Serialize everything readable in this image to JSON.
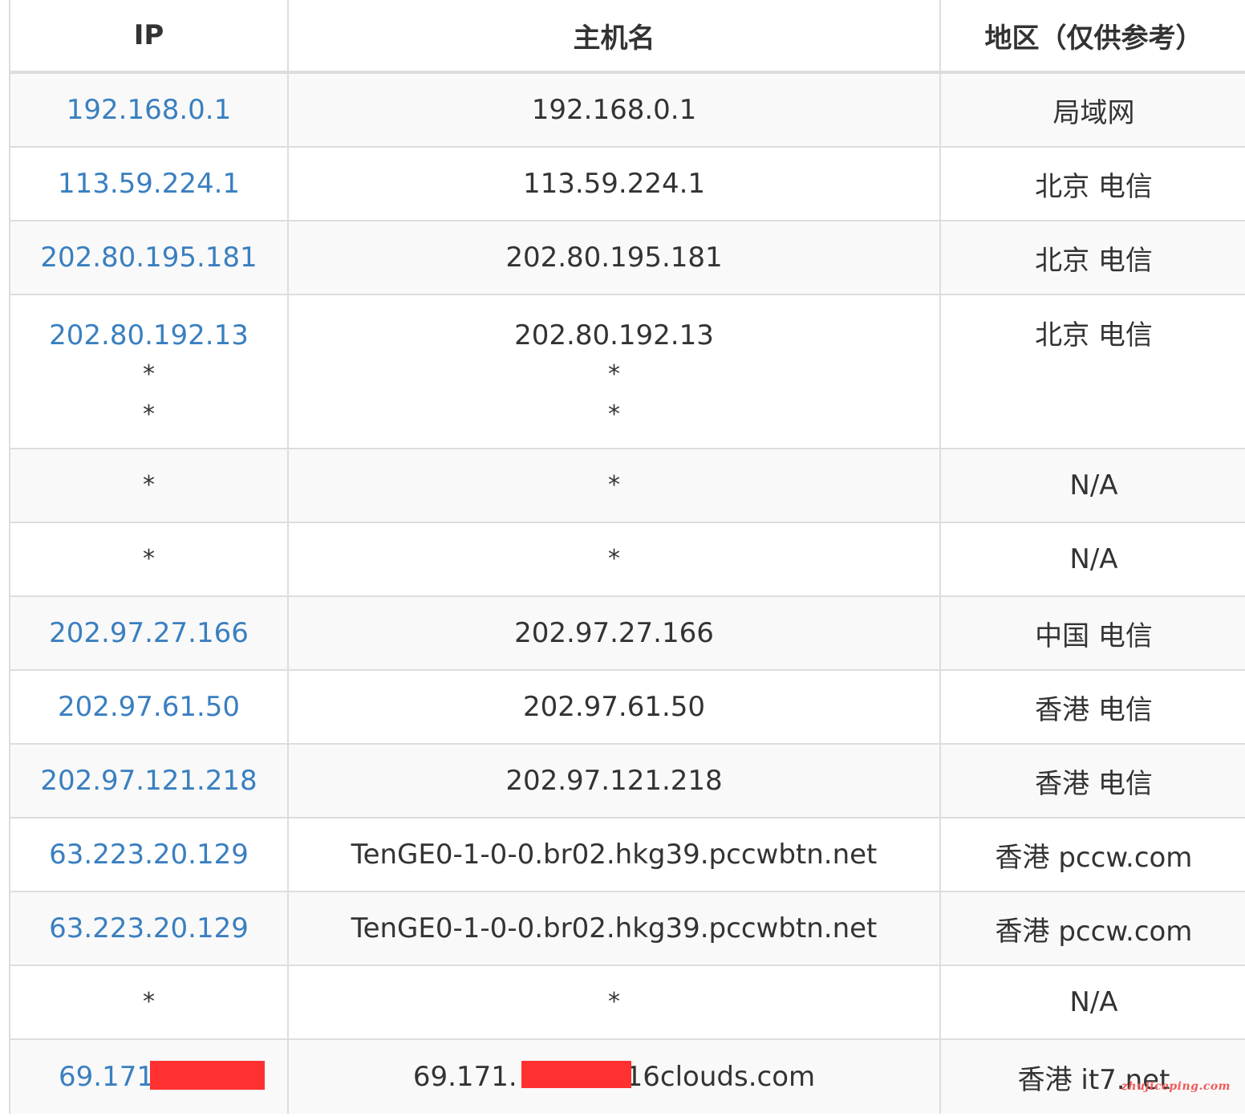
{
  "table": {
    "headers": {
      "ip": "IP",
      "hostname": "主机名",
      "region": "地区（仅供参考）"
    },
    "rows": [
      {
        "ip": "192.168.0.1",
        "hostname": "192.168.0.1",
        "region": "局域网"
      },
      {
        "ip": "113.59.224.1",
        "hostname": "113.59.224.1",
        "region": "北京 电信"
      },
      {
        "ip": "202.80.195.181",
        "hostname": "202.80.195.181",
        "region": "北京 电信"
      },
      {
        "ip": "202.80.192.13",
        "ip_extra": [
          "*",
          "*"
        ],
        "hostname": "202.80.192.13",
        "hostname_extra": [
          "*",
          "*"
        ],
        "region": "北京 电信"
      },
      {
        "ip": "*",
        "hostname": "*",
        "region": "N/A"
      },
      {
        "ip": "*",
        "hostname": "*",
        "region": "N/A"
      },
      {
        "ip": "202.97.27.166",
        "hostname": "202.97.27.166",
        "region": "中国 电信"
      },
      {
        "ip": "202.97.61.50",
        "hostname": "202.97.61.50",
        "region": "香港 电信"
      },
      {
        "ip": "202.97.121.218",
        "hostname": "202.97.121.218",
        "region": "香港 电信"
      },
      {
        "ip": "63.223.20.129",
        "hostname": "TenGE0-1-0-0.br02.hkg39.pccwbtn.net",
        "region": "香港 pccw.com"
      },
      {
        "ip": "63.223.20.129",
        "hostname": "TenGE0-1-0-0.br02.hkg39.pccwbtn.net",
        "region": "香港 pccw.com"
      },
      {
        "ip": "*",
        "hostname": "*",
        "region": "N/A"
      },
      {
        "ip": "69.171.",
        "hostname": "69.171.",
        "hostname_suffix": "16clouds.com",
        "region": "香港 it7.net"
      }
    ]
  },
  "watermark": "zhujiceping.com",
  "colors": {
    "link": "#3a7fc0",
    "text": "#333333",
    "border": "#dddddd",
    "stripe": "#f9f9f9",
    "redaction": "#ff3030"
  }
}
